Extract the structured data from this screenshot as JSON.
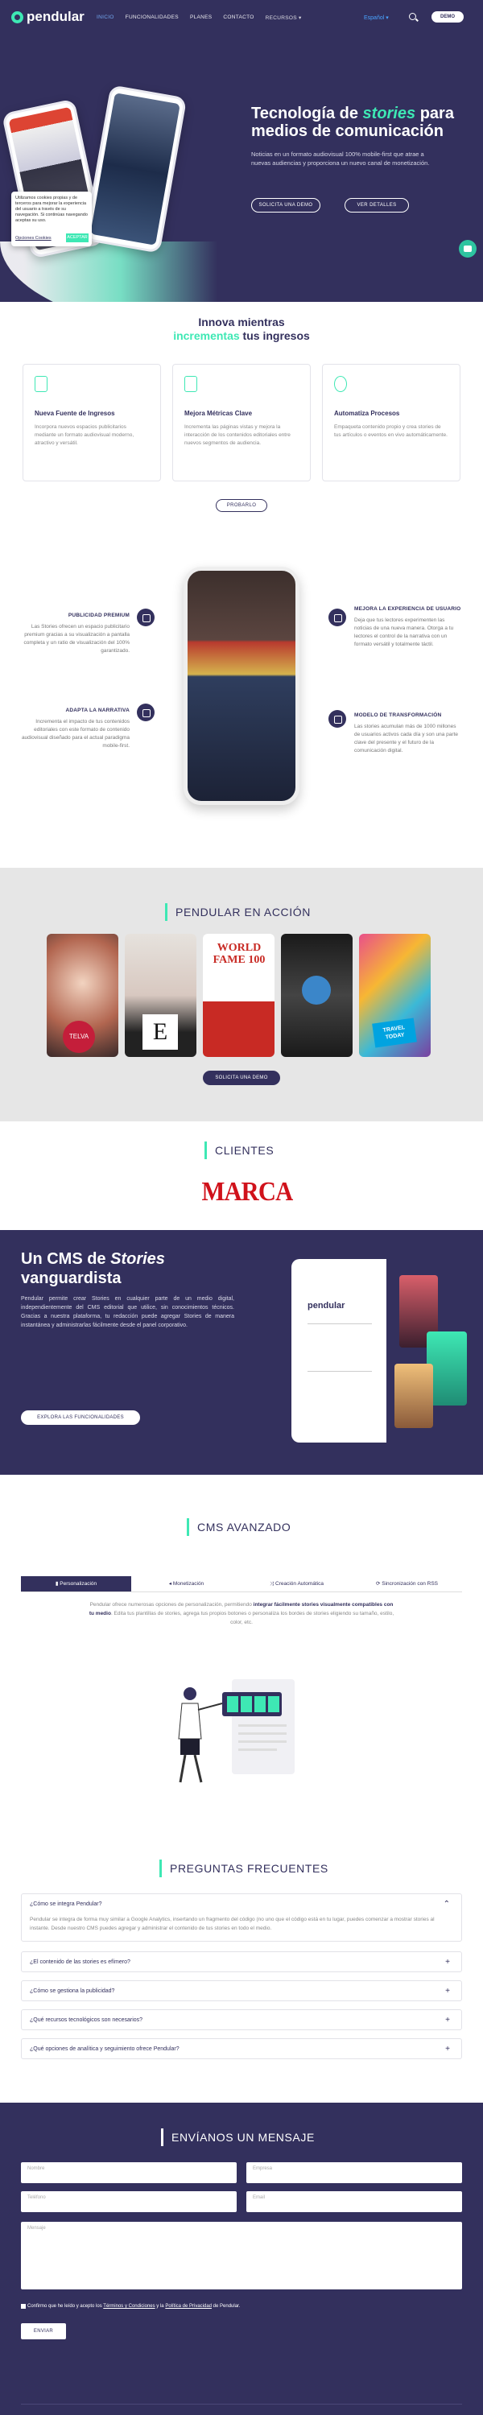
{
  "nav": {
    "brand": "pendular",
    "links": [
      "INICIO",
      "FUNCIONALIDADES",
      "PLANES",
      "CONTACTO",
      "RECURSOS"
    ],
    "active": "INICIO",
    "language": "Español",
    "demo_label": "DEMO"
  },
  "hero": {
    "title_pre": "Tecnología de ",
    "title_em": "stories",
    "title_post": " para medios de comunicación",
    "description": "Noticias en un formato audiovisual 100% mobile-first que atrae a nuevas audiencias y proporciona un nuevo canal de monetización.",
    "demo_button": "SOLICITA UNA DEMO",
    "details_button": "VER DETALLES"
  },
  "cookie": {
    "text": "Utilizamos cookies propias y de terceros para mejorar la experiencia del usuario a través de su navegación. Si continúas navegando aceptas su uso.",
    "options": "Opciones Cookies",
    "accept": "ACEPTAR"
  },
  "innova": {
    "line1": "Innova mientras",
    "em": "incrementas",
    "rest": " tus ingresos",
    "cards": [
      {
        "title": "Nueva Fuente de Ingresos",
        "text": "Incorpora nuevos espacios publicitarios mediante un formato audiovisual moderno, atractivo y versátil."
      },
      {
        "title": "Mejora Métricas Clave",
        "text": "Incrementa las páginas vistas y mejora la interacción de los contenidos editoriales entre nuevos segmentos de audiencia."
      },
      {
        "title": "Automatiza Procesos",
        "text": "Empaqueta contenido propio y crea stories de tus artículos o eventos en vivo automáticamente."
      }
    ],
    "pill": "PROBARLO"
  },
  "features": {
    "left": [
      {
        "title": "PUBLICIDAD PREMIUM",
        "text": "Las Stories ofrecen un espacio publicitario premium gracias a su visualización a pantalla completa y un ratio de visualización del 100% garantizado."
      },
      {
        "title": "ADAPTA LA NARRATIVA",
        "text": "Incrementa el impacto de tus contenidos editoriales con este formato de contenido audiovisual diseñado para el actual paradigma mobile-first."
      }
    ],
    "right": [
      {
        "title": "MEJORA LA EXPERIENCIA DE USUARIO",
        "text": "Deja que tus lectores experimenten las noticias de una nueva manera. Otorga a tu lectores el control de la narrativa con un formato versátil y totalmente táctil."
      },
      {
        "title": "MODELO DE TRANSFORMACIÓN",
        "text": "Las stories acumulan más de 1000 millones de usuarios activos cada día y son una parte clave del presente y el futuro de la comunicación digital."
      }
    ]
  },
  "accion": {
    "title": "PENDULAR EN ACCIÓN",
    "story_texts": [
      "TELVA",
      "E",
      "WORLD FAME 100",
      "",
      "TRAVEL TODAY"
    ],
    "button": "SOLICITA UNA DEMO"
  },
  "clientes": {
    "title": "CLIENTES",
    "logo": "MARCA"
  },
  "cms": {
    "title_pre": "Un CMS de ",
    "title_em": "Stories",
    "title_post": " vanguardista",
    "description": "Pendular permite crear Stories en cualquier parte de un medio digital, independientemente del CMS editorial que utilice, sin conocimientos técnicos. Gracias a nuestra plataforma, tu redacción puede agregar Stories de manera instantánea y administrarlas fácilmente desde el panel corporativo.",
    "button": "EXPLORA LAS FUNCIONALIDADES",
    "laptop_brand": "pendular"
  },
  "cms_avanzado": {
    "title": "CMS AVANZADO",
    "tabs": [
      "Personalización",
      "Monetización",
      "Creación Automática",
      "Sincronización con RSS"
    ],
    "active_tab": "Personalización",
    "desc_pre": "Pendular ofrece numerosas opciones de personalización, permitiendo ",
    "desc_bold": "integrar fácilmente stories visualmente compatibles con tu medio",
    "desc_post": ". Edita tus plantillas de stories, agrega tus propios botones o personaliza los bordes de stories eligiendo su tamaño, estilo, color, etc."
  },
  "faq": {
    "title": "PREGUNTAS FRECUENTES",
    "items": [
      {
        "q": "¿Cómo se integra Pendular?",
        "a": "Pendular se integra de forma muy similar a Google Analytics, insertando un fragmento del código (no uno que el código está en tu lugar, puedes comenzar a mostrar stories al instante. Desde nuestro CMS puedes agregar y administrar el contenido de tus stories en todo el medio.",
        "open": true
      },
      {
        "q": "¿El contenido de las stories es efímero?",
        "open": false
      },
      {
        "q": "¿Cómo se gestiona la publicidad?",
        "open": false
      },
      {
        "q": "¿Qué recursos tecnológicos son necesarios?",
        "open": false
      },
      {
        "q": "¿Qué opciones de analítica y seguimiento ofrece Pendular?",
        "open": false
      }
    ]
  },
  "mensaje": {
    "title": "ENVÍANOS UN MENSAJE",
    "fields": {
      "nombre": "Nombre",
      "empresa": "Empresa",
      "telefono": "Teléfono",
      "email": "Email",
      "mensaje": "Mensaje"
    },
    "consent_pre": "Confirmo que he leído y acepto los ",
    "terms": "Términos y Condiciones",
    "consent_mid": " y la ",
    "privacy": "Política de Privacidad",
    "consent_post": " de Pendular.",
    "send": "ENVIAR"
  },
  "colors": {
    "navy": "#33305d",
    "accent": "#3ee8b4",
    "marca_red": "#d0121b"
  }
}
